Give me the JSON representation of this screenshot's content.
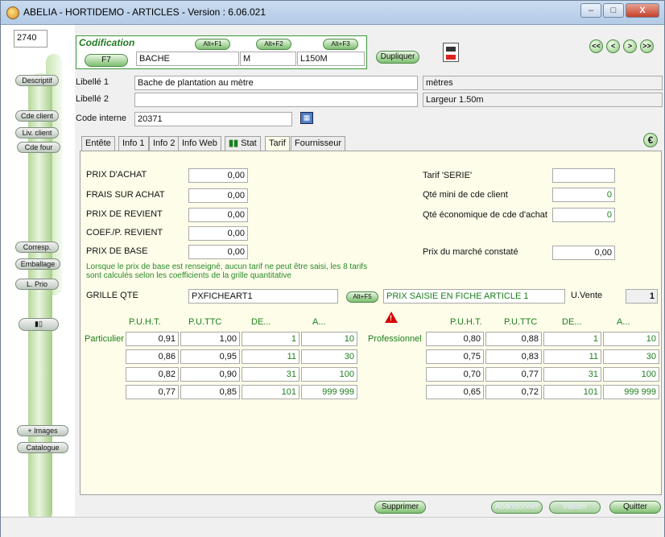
{
  "window": {
    "title": "ABELIA  -  HORTIDEMO  -  ARTICLES  -  Version : 6.06.021",
    "minimize": "–",
    "maximize": "□",
    "close": "X"
  },
  "sidebar": {
    "code": "2740",
    "items": [
      "Descriptif",
      "Cde client",
      "Liv. client",
      "Cde four",
      "Corresp.",
      "Emballage",
      "L. Prio",
      "+ Images",
      "Catalogue"
    ]
  },
  "codification": {
    "label": "Codification",
    "f7": "F7",
    "alt_f1": "Alt+F1",
    "alt_f2": "Alt+F2",
    "alt_f3": "Alt+F3",
    "code1": "BACHE",
    "code2": "M",
    "code3": "L150M",
    "dupliquer": "Dupliquer"
  },
  "nav": {
    "first": "<<",
    "prev": "<",
    "next": ">",
    "last": ">>"
  },
  "fields": {
    "libelle1_label": "Libellé 1",
    "libelle1": "Bache de plantation au mètre",
    "libelle2_label": "Libellé 2",
    "libelle2": "",
    "code_interne_label": "Code interne",
    "code_interne": "20371",
    "unite": "mètres",
    "desc2": "Largeur 1.50m"
  },
  "tabs": [
    "Entête",
    "Info 1",
    "Info 2",
    "Info Web",
    "Stat",
    "Tarif",
    "Fournisseur"
  ],
  "tarif": {
    "prix_achat_label": "PRIX D'ACHAT",
    "prix_achat": "0,00",
    "frais_label": "FRAIS SUR ACHAT",
    "frais": "0,00",
    "prix_revient_label": "PRIX DE REVIENT",
    "prix_revient": "0,00",
    "coef_label": "COEF./P. REVIENT",
    "coef": "0,00",
    "prix_base_label": "PRIX DE BASE",
    "prix_base": "0,00",
    "tarif_serie_label": "Tarif 'SERIE'",
    "tarif_serie": "",
    "qte_mini_label": "Qté mini de cde client",
    "qte_mini": "0",
    "qte_eco_label": "Qté économique de cde d'achat",
    "qte_eco": "0",
    "prix_marche_label": "Prix du marché constaté",
    "prix_marche": "0,00",
    "note_line1": "Lorsque le prix de base est renseigné, aucun tarif ne peut être saisi, les 8 tarifs",
    "note_line2": "sont calculés selon les coefficients de la grille quantitative",
    "grille_label": "GRILLE QTE",
    "grille": "PXFICHEART1",
    "alt_f5": "Alt+F5",
    "grille_desc": "PRIX SAISIE EN FICHE ARTICLE 1",
    "uvente_label": "U.Vente",
    "uvente": "1",
    "col_headers": [
      "P.U.H.T.",
      "P.U.TTC",
      "DE...",
      "A..."
    ],
    "particulier_label": "Particulier",
    "professionnel_label": "Professionnel",
    "particulier": [
      [
        "0,91",
        "1,00",
        "1",
        "10"
      ],
      [
        "0,86",
        "0,95",
        "11",
        "30"
      ],
      [
        "0,82",
        "0,90",
        "31",
        "100"
      ],
      [
        "0,77",
        "0,85",
        "101",
        "999 999"
      ]
    ],
    "professionnel": [
      [
        "0,80",
        "0,88",
        "1",
        "10"
      ],
      [
        "0,75",
        "0,83",
        "11",
        "30"
      ],
      [
        "0,70",
        "0,77",
        "31",
        "100"
      ],
      [
        "0,65",
        "0,72",
        "101",
        "999 999"
      ]
    ]
  },
  "actions": {
    "supprimer": "Supprimer",
    "abandonner": "Abandonner",
    "valider": "Valider",
    "quitter": "Quitter"
  },
  "euro": "€"
}
